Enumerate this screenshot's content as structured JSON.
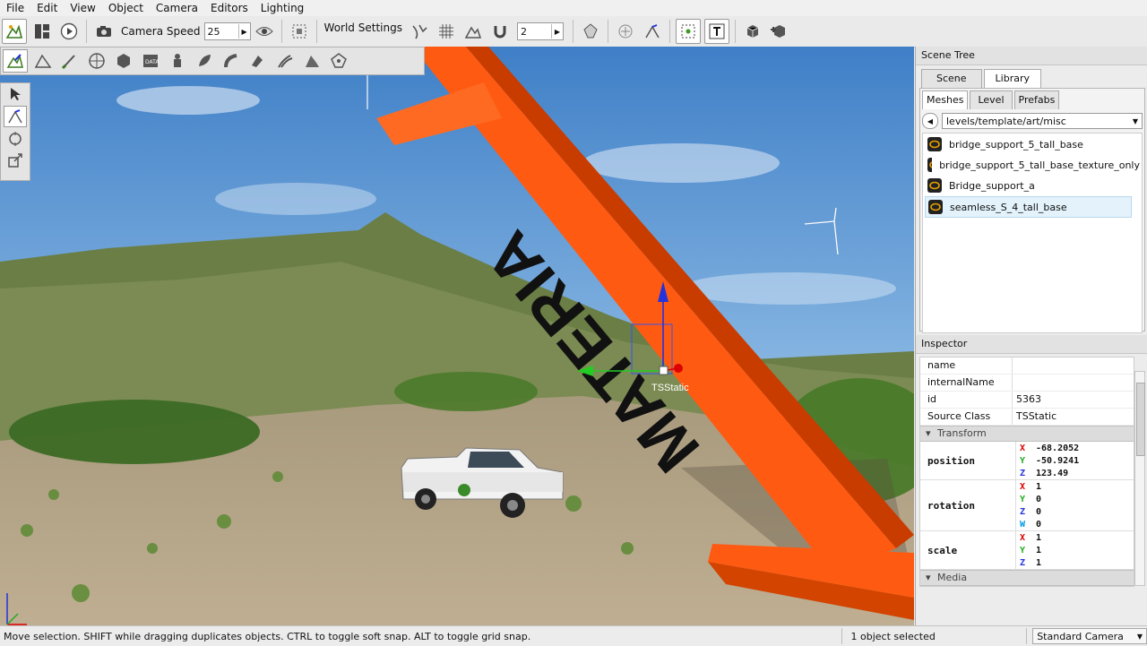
{
  "menu": [
    "File",
    "Edit",
    "View",
    "Object",
    "Camera",
    "Editors",
    "Lighting"
  ],
  "toolbar": {
    "camera_speed_label": "Camera Speed",
    "camera_speed_value": "25",
    "world_settings_label": "World Settings",
    "snap_value": "2"
  },
  "viewport": {
    "object_label": "TSStatic",
    "sign_text": "MATERIA"
  },
  "scene_tree": {
    "title": "Scene Tree",
    "tabs": [
      "Scene",
      "Library"
    ],
    "active_tab": "Library",
    "subtabs": [
      "Meshes",
      "Level",
      "Prefabs"
    ],
    "path": "levels/template/art/misc",
    "meshes": [
      "bridge_support_5_tall_base",
      "bridge_support_5_tall_base_texture_only",
      "Bridge_support_a",
      "seamless_S_4_tall_base"
    ],
    "selected_mesh_index": 3
  },
  "inspector": {
    "title": "Inspector",
    "fields": [
      {
        "key": "name",
        "value": ""
      },
      {
        "key": "internalName",
        "value": ""
      },
      {
        "key": "id",
        "value": "5363"
      },
      {
        "key": "Source Class",
        "value": "TSStatic"
      }
    ],
    "transform_label": "Transform",
    "position_label": "position",
    "position": {
      "x": "-68.2052",
      "y": "-50.9241",
      "z": "123.49"
    },
    "rotation_label": "rotation",
    "rotation": {
      "x": "1",
      "y": "0",
      "z": "0",
      "w": "0"
    },
    "scale_label": "scale",
    "scale": {
      "x": "1",
      "y": "1",
      "z": "1"
    },
    "media_label": "Media"
  },
  "status": {
    "message": "Move selection.  SHIFT while dragging duplicates objects.  CTRL to toggle soft snap.  ALT to toggle grid snap.",
    "selection_count": "1 object selected",
    "camera_mode": "Standard Camera"
  },
  "colors": {
    "accent_orange": "#ff5a12",
    "axis_x": "#dd0000",
    "axis_y": "#22aa22",
    "axis_z": "#2233dd",
    "axis_w": "#0099dd",
    "selection_row": "#e3f2fb"
  }
}
